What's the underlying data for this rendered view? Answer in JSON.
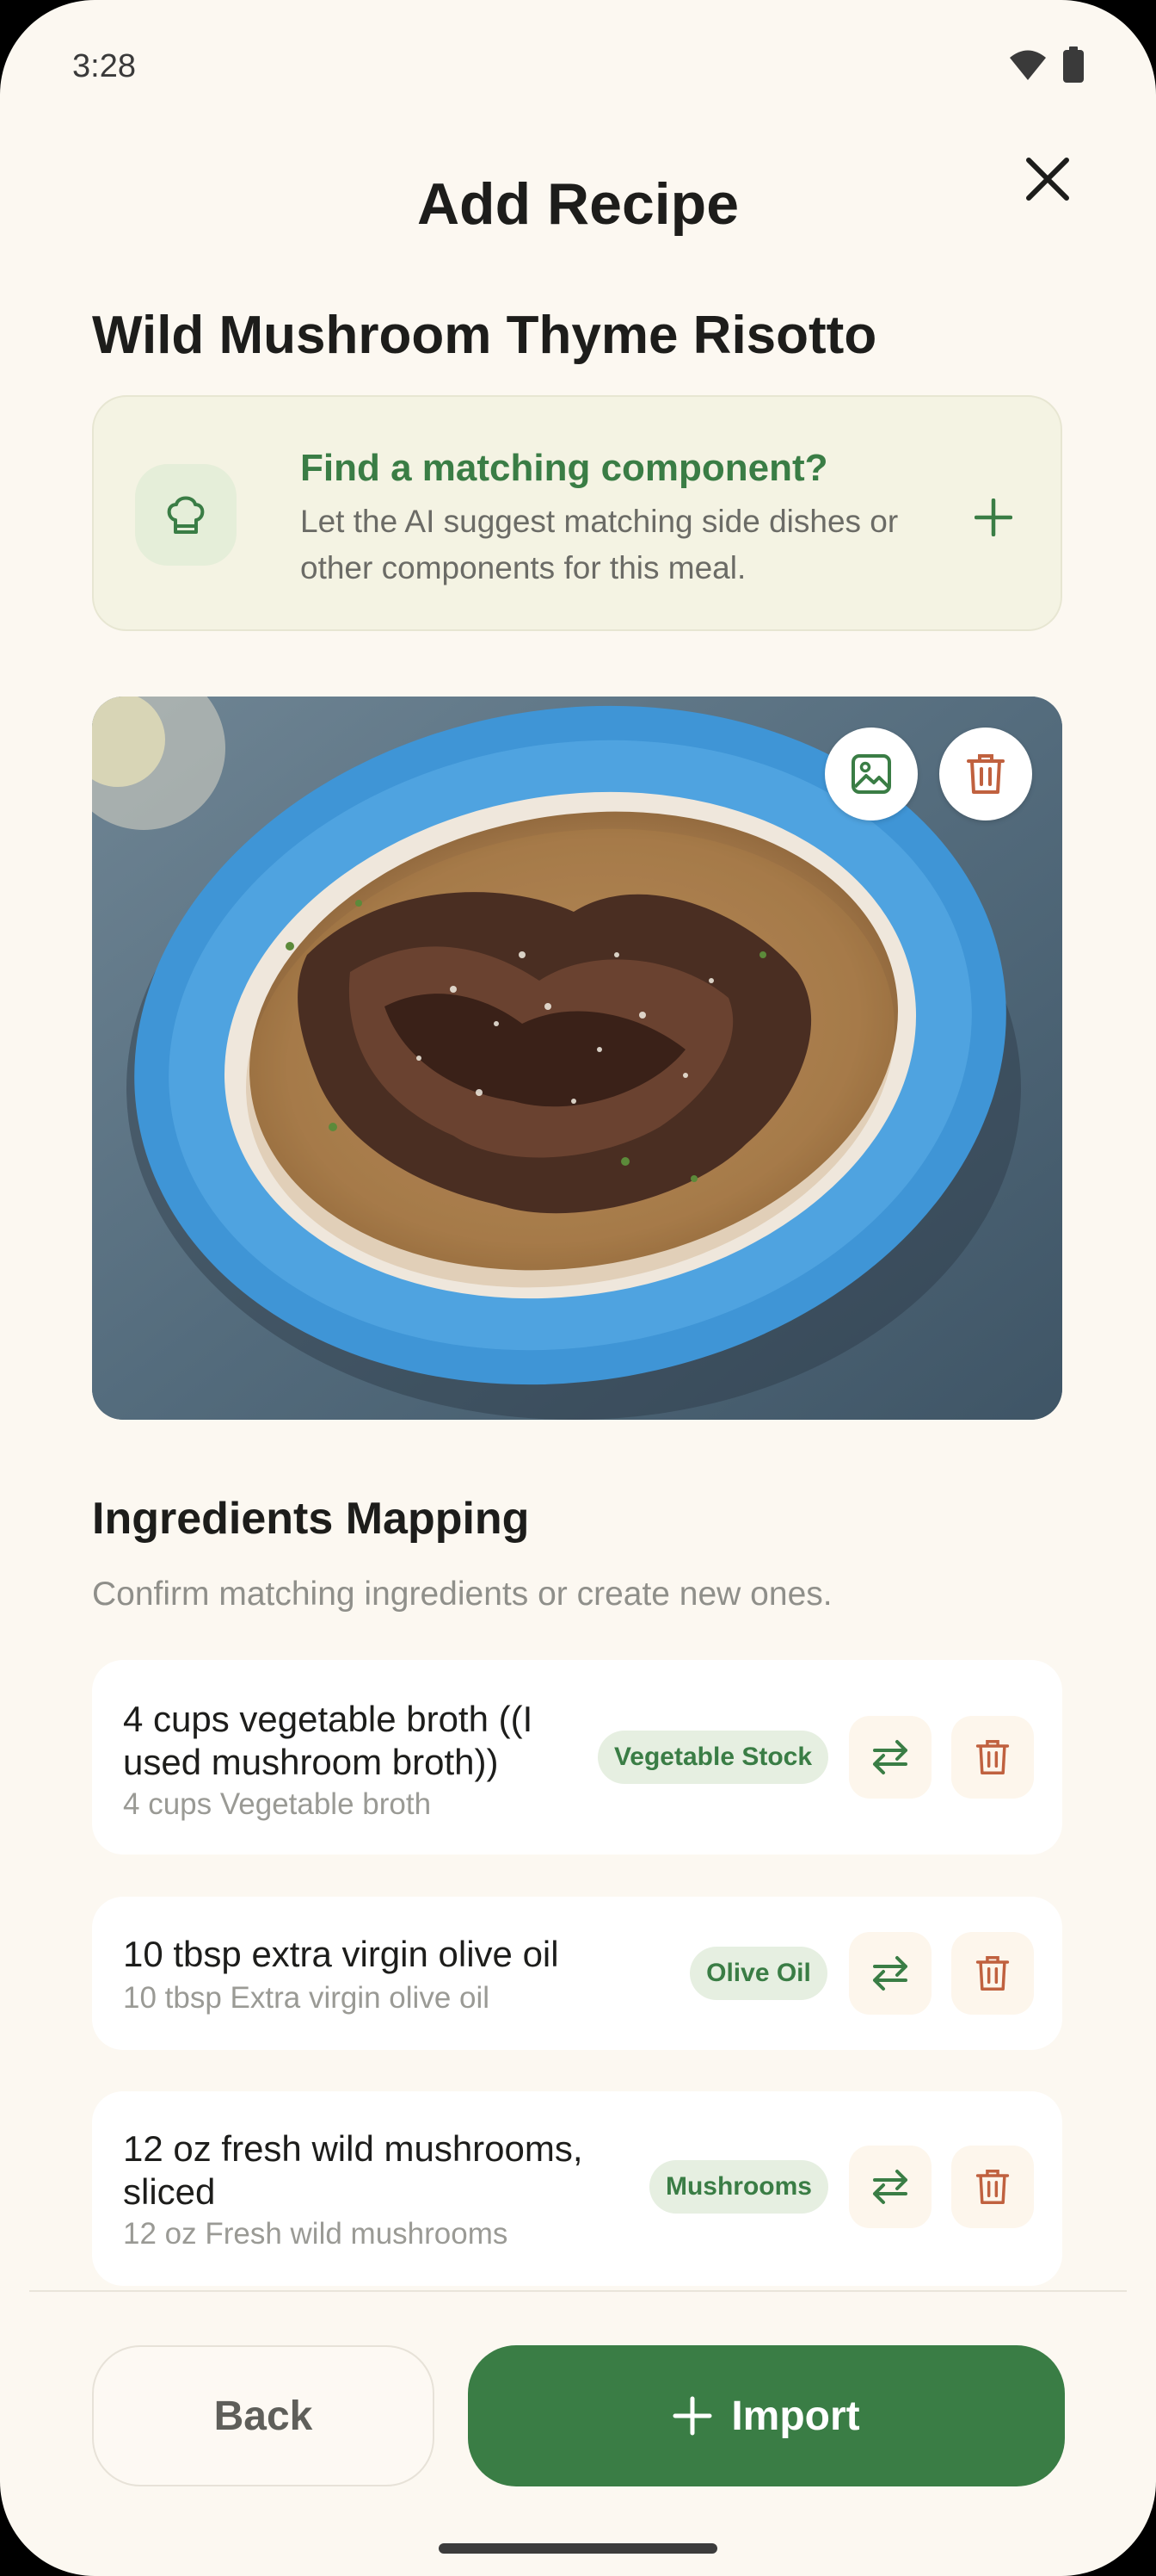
{
  "status_bar": {
    "time": "3:28"
  },
  "header": {
    "title": "Add Recipe"
  },
  "recipe": {
    "title": "Wild Mushroom Thyme Risotto"
  },
  "suggestion": {
    "title": "Find a matching component?",
    "text": "Let the AI suggest matching side dishes or other components for this meal."
  },
  "ingredients_section": {
    "title": "Ingredients Mapping",
    "subtitle": "Confirm matching ingredients or create new ones."
  },
  "ingredients": [
    {
      "name": "4 cups vegetable broth ((I used mushroom broth))",
      "parsed": "4 cups Vegetable broth",
      "match": "Vegetable Stock"
    },
    {
      "name": "10 tbsp extra virgin olive oil",
      "parsed": "10 tbsp Extra virgin olive oil",
      "match": "Olive Oil"
    },
    {
      "name": "12 oz fresh wild mushrooms, sliced",
      "parsed": "12 oz Fresh wild mushrooms",
      "match": "Mushrooms"
    }
  ],
  "footer": {
    "back_label": "Back",
    "import_label": "Import"
  },
  "colors": {
    "accent": "#3a7d45",
    "danger": "#c0613f",
    "background": "#fcf8f1"
  },
  "icons": [
    "close-icon",
    "chef-hat-icon",
    "plus-icon",
    "image-icon",
    "trash-icon",
    "swap-icon",
    "wifi-icon",
    "battery-icon"
  ]
}
